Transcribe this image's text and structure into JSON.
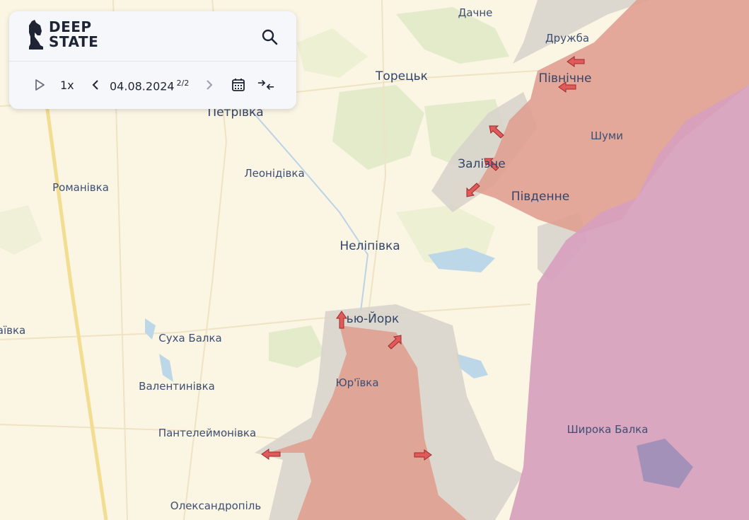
{
  "logo": {
    "line1": "DEEP",
    "line2": "STATE"
  },
  "player": {
    "speed": "1x",
    "date": "04.08.2024",
    "date_suffix": "2/2"
  },
  "icons": {
    "logo": "chess-knight-icon",
    "search": "search-icon",
    "play": "play-icon",
    "prev": "chevron-left-icon",
    "next": "chevron-right-icon",
    "calendar": "calendar-icon",
    "compare": "compare-arrows-icon"
  },
  "colors": {
    "land": "#fbf5e4",
    "occupied": "#e0a090",
    "occupied_long": "#d7a0be",
    "grey_zone": "#d5d0c8",
    "advance_arrow": "#e05a5a"
  },
  "places": {
    "dachne": "Дачне",
    "druzhba": "Дружба",
    "toretsk": "Торецьк",
    "pivnichne": "Північне",
    "petrivka": "Петрівка",
    "shumy": "Шуми",
    "leonidivka": "Леонідівка",
    "zalizne": "Залізне",
    "romanivka": "Романівка",
    "pivdenne": "Південне",
    "nelipivka": "Неліпівка",
    "niu_york": "ью-Йорк",
    "vka": "аївка",
    "sukha_balka": "Суха Балка",
    "yurivka": "Юр'ївка",
    "valentynivka": "Валентинівка",
    "shyroka_balka": "Широка Балка",
    "panteleimonivka": "Пантелеймонівка",
    "oleksandropil": "Олександропіль"
  }
}
